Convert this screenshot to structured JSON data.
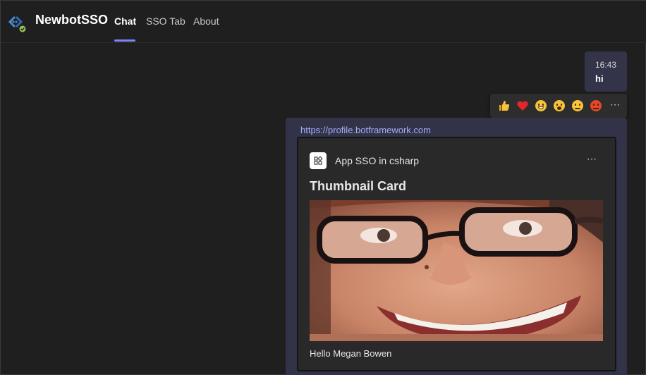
{
  "app": {
    "title": "NewbotSSO",
    "icon": "bot-diamond-icon",
    "status": "available-check-icon"
  },
  "tabs": [
    {
      "label": "Chat",
      "active": true
    },
    {
      "label": "SSO Tab",
      "active": false
    },
    {
      "label": "About",
      "active": false
    }
  ],
  "user_message": {
    "time": "16:43",
    "text": "hi"
  },
  "reactions": [
    {
      "name": "like",
      "icon": "thumbs-up-icon"
    },
    {
      "name": "heart",
      "icon": "heart-icon"
    },
    {
      "name": "laugh",
      "icon": "laugh-icon"
    },
    {
      "name": "surprised",
      "icon": "surprised-icon"
    },
    {
      "name": "sad",
      "icon": "sad-icon"
    },
    {
      "name": "angry",
      "icon": "angry-icon"
    },
    {
      "name": "more",
      "icon": "more-options-icon"
    }
  ],
  "bot_message": {
    "link": "https://profile.botframework.com",
    "card": {
      "app_name": "App SSO in csharp",
      "title": "Thumbnail Card",
      "image": "portrait-photo-smiling-woman-glasses",
      "text": "Hello Megan Bowen"
    }
  },
  "colors": {
    "background": "#1f1f1f",
    "accent": "#7f85f5",
    "message_bubble": "#33344a",
    "link": "#a7acf5",
    "card": "#292929"
  }
}
